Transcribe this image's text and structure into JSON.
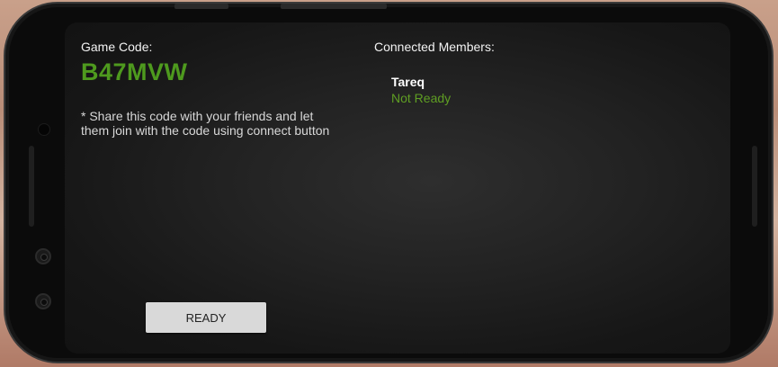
{
  "game": {
    "code_label": "Game Code:",
    "code": "B47MVW",
    "share_note": "* Share this code with your friends and let them join with the code using connect button"
  },
  "members": {
    "label": "Connected Members:",
    "list": [
      {
        "name": "Tareq",
        "status": "Not Ready"
      }
    ]
  },
  "actions": {
    "ready_label": "READY"
  },
  "colors": {
    "accent_green": "#4e9a1e",
    "status_green": "#5f9e23",
    "button_bg": "#d9d9d9"
  }
}
